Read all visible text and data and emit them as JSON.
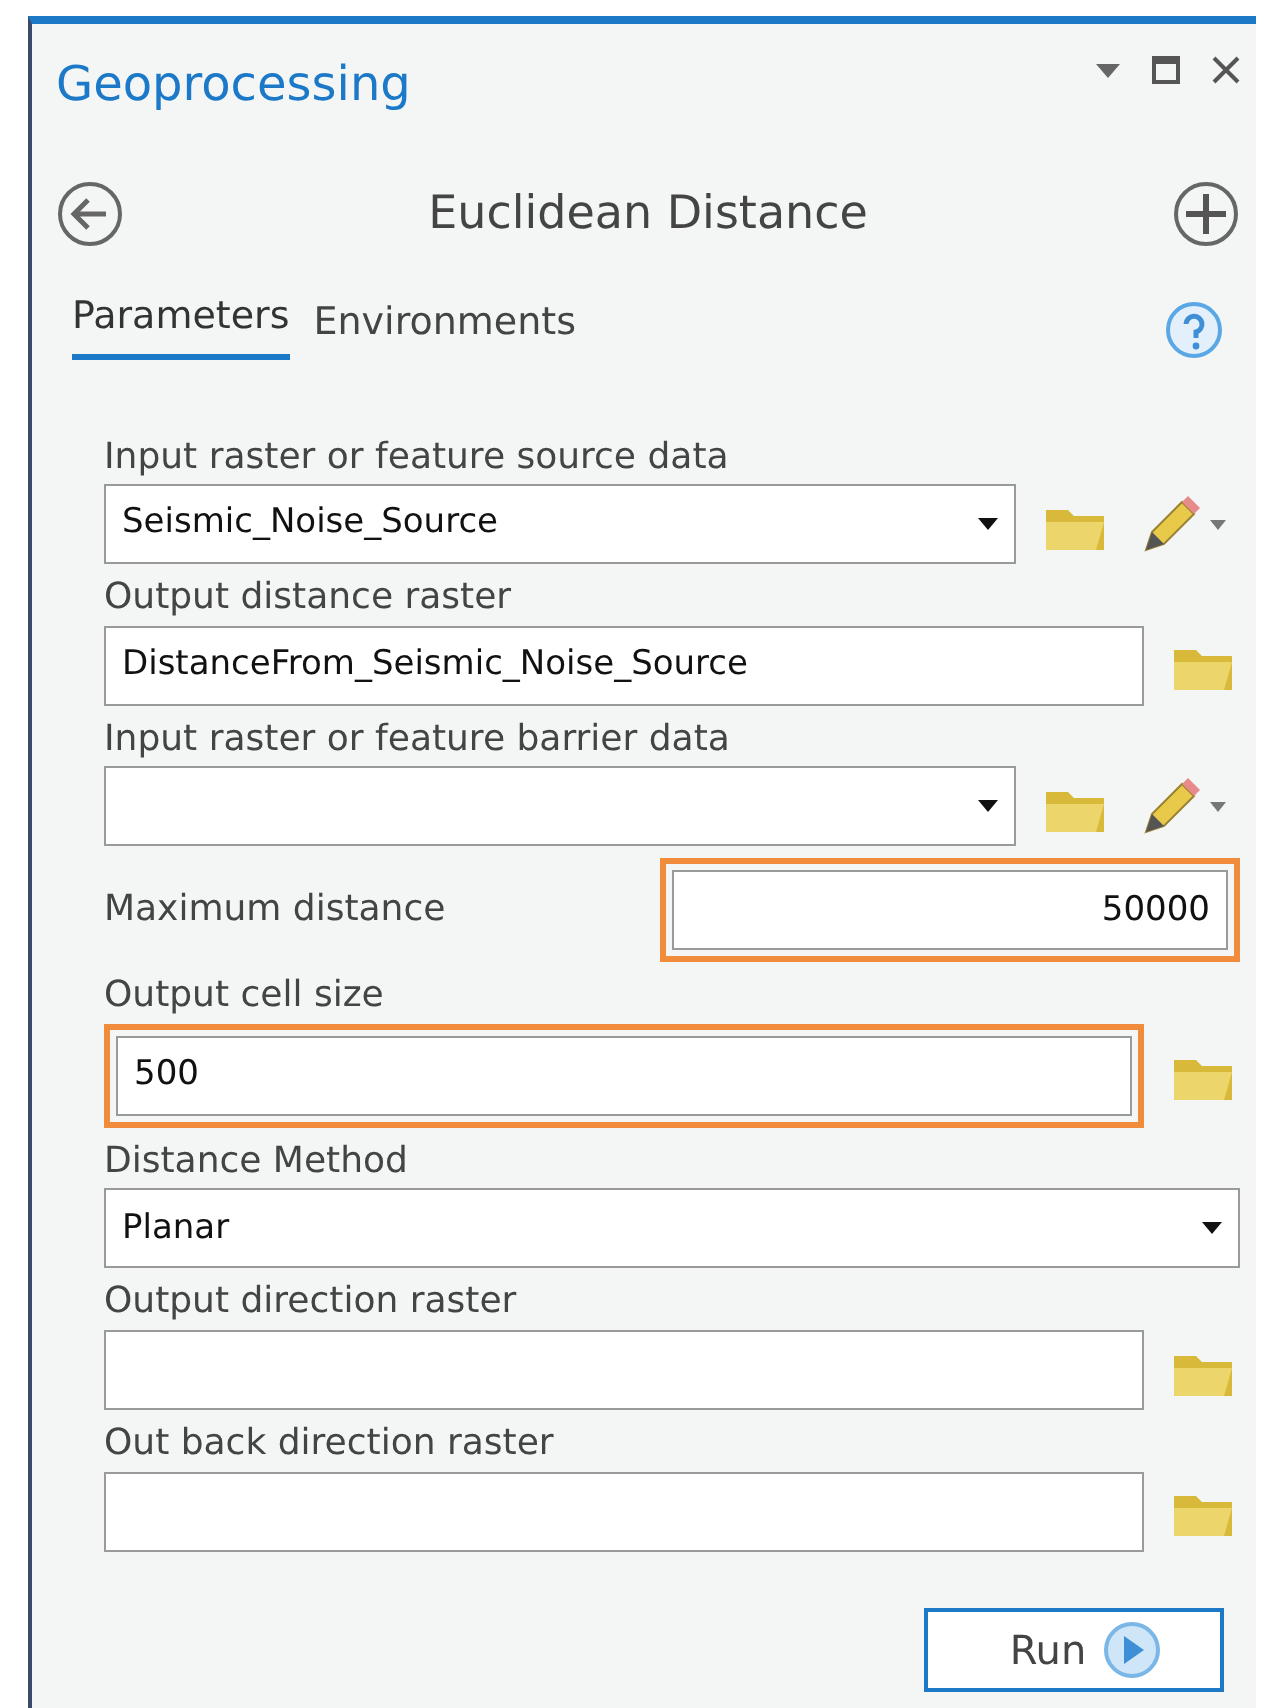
{
  "window": {
    "title": "Geoprocessing"
  },
  "tool": {
    "title": "Euclidean Distance"
  },
  "tabs": [
    {
      "label": "Parameters",
      "selected": true
    },
    {
      "label": "Environments",
      "selected": false
    }
  ],
  "parameters": [
    {
      "label": "Input raster or feature source data",
      "kind": "dropdown",
      "value": "Seismic_Noise_Source",
      "browse": true,
      "sketch": true,
      "highlighted": false
    },
    {
      "label": "Output distance raster",
      "kind": "text",
      "value": "DistanceFrom_Seismic_Noise_Source",
      "browse": true,
      "highlighted": false
    },
    {
      "label": "Input raster or feature barrier data",
      "kind": "dropdown",
      "browse": true,
      "sketch": true,
      "highlighted": false
    },
    {
      "label": "Maximum distance",
      "kind": "inline",
      "value": "50000",
      "highlighted": true
    },
    {
      "label": "Output cell size",
      "kind": "text",
      "value": "500",
      "browse": true,
      "highlighted": true
    },
    {
      "label": "Distance Method",
      "kind": "dropdown",
      "value": "Planar",
      "highlighted": false
    },
    {
      "label": "Output direction raster",
      "kind": "text",
      "browse": true,
      "highlighted": false
    },
    {
      "label": "Out back direction raster",
      "kind": "text",
      "browse": true,
      "highlighted": false
    }
  ],
  "run_button": {
    "label": "Run"
  }
}
